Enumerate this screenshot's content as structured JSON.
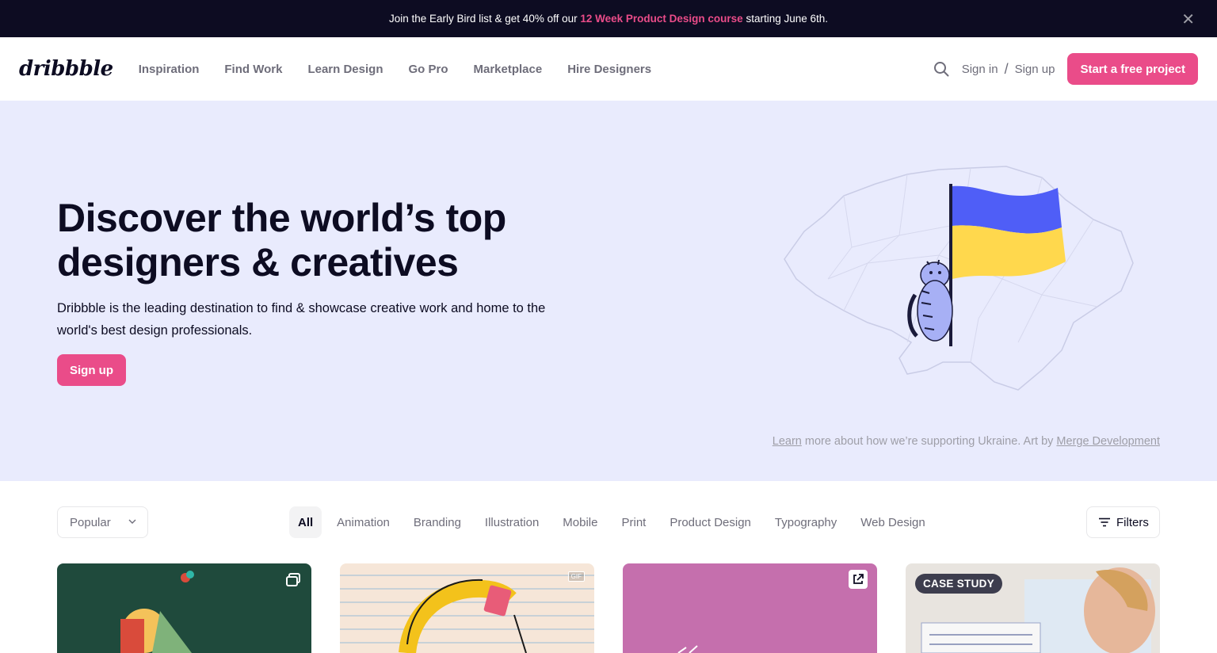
{
  "banner": {
    "prefix": "Join the Early Bird list & get 40% off our ",
    "highlight": "12 Week Product Design course",
    "suffix": " starting June 6th.",
    "close_icon": "close-icon"
  },
  "nav": {
    "logo": "dribbble",
    "links": [
      "Inspiration",
      "Find Work",
      "Learn Design",
      "Go Pro",
      "Marketplace",
      "Hire Designers"
    ],
    "sign_in": "Sign in",
    "separator": "/",
    "sign_up": "Sign up",
    "cta": "Start a free project"
  },
  "hero": {
    "title": "Discover the world’s top designers & creatives",
    "description": "Dribbble is the leading destination to find & showcase creative work and home to the world's best design professionals.",
    "signup": "Sign up",
    "credit": {
      "learn": "Learn",
      "middle": " more about how we’re supporting Ukraine. Art by ",
      "artist": "Merge Development"
    }
  },
  "filters": {
    "sort": "Popular",
    "categories": [
      "All",
      "Animation",
      "Branding",
      "Illustration",
      "Mobile",
      "Print",
      "Product Design",
      "Typography",
      "Web Design"
    ],
    "active_category": "All",
    "filters_label": "Filters"
  },
  "shots": {
    "s1": {
      "badge": "multiple-shots-icon"
    },
    "s2": {
      "badge": "GIF"
    },
    "s3": {
      "badge": "external-link-icon"
    },
    "s4": {
      "badge": "CASE STUDY"
    }
  },
  "colors": {
    "brand_pink": "#ea4c89",
    "dark": "#0d0c22",
    "hero_bg": "#e9ebfd",
    "flag_blue": "#4f5ef7",
    "flag_yellow": "#ffd84d"
  }
}
